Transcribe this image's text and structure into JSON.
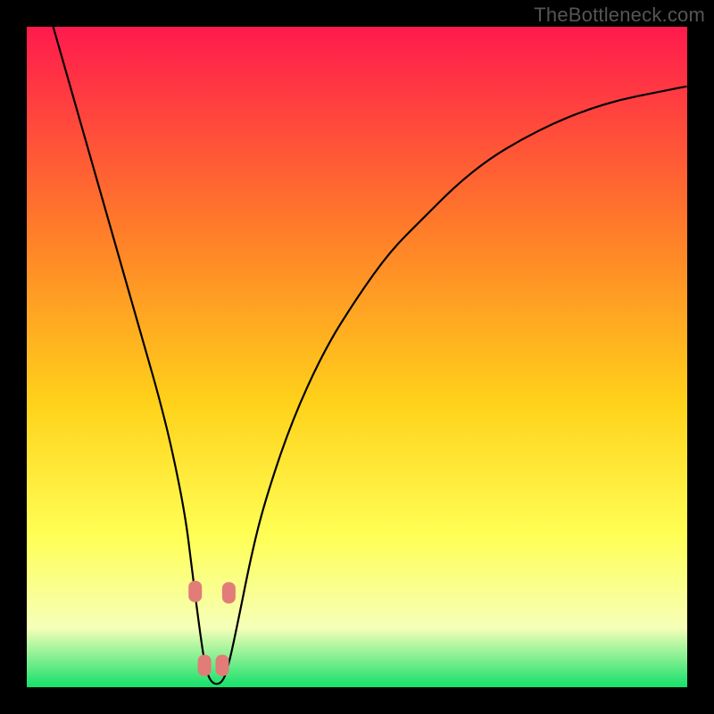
{
  "watermark": "TheBottleneck.com",
  "colors": {
    "frame": "#000000",
    "gradient_top": "#ff1a4d",
    "gradient_mid1": "#ff7a2a",
    "gradient_mid2": "#ffd21a",
    "gradient_mid3": "#ffff55",
    "gradient_mid4": "#f6ffb8",
    "gradient_bottom": "#15e06b",
    "curve": "#000000",
    "marker": "#e17c78",
    "watermark_text": "#555555"
  },
  "chart_data": {
    "type": "line",
    "title": "",
    "xlabel": "",
    "ylabel": "",
    "ylim": [
      0,
      100
    ],
    "xlim": [
      0,
      100
    ],
    "series": [
      {
        "name": "curve",
        "x": [
          4,
          6,
          8,
          10,
          12,
          14,
          16,
          18,
          20,
          22,
          24,
          25,
          26,
          27,
          28,
          29.5,
          30.5,
          32,
          34,
          36,
          40,
          45,
          50,
          55,
          60,
          65,
          70,
          75,
          80,
          85,
          90,
          95,
          100
        ],
        "y": [
          100,
          93,
          86,
          79,
          72,
          65,
          58,
          51,
          44,
          36,
          26,
          18,
          10,
          3,
          0.5,
          0.5,
          3,
          10,
          20,
          28,
          40,
          51,
          59,
          66,
          71,
          76,
          80,
          83,
          85.5,
          87.5,
          89,
          90,
          91
        ]
      }
    ],
    "markers": [
      {
        "x": 25.5,
        "y": 14.5
      },
      {
        "x": 30.6,
        "y": 14.3
      },
      {
        "x": 26.9,
        "y": 3.3
      },
      {
        "x": 29.6,
        "y": 3.3
      }
    ],
    "min_x": 28.2
  }
}
